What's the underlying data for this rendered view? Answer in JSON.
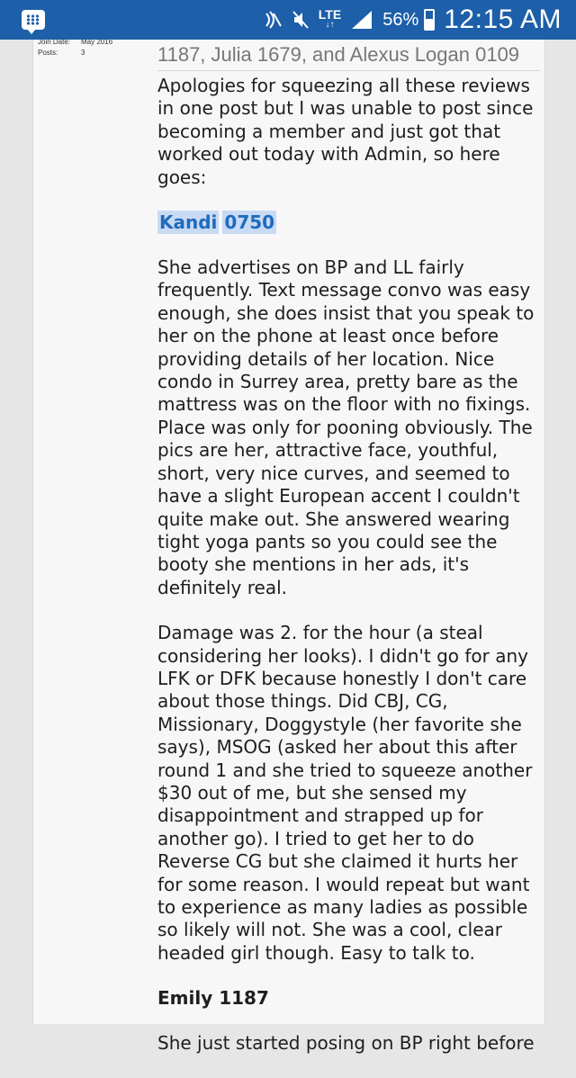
{
  "status_bar": {
    "network": "LTE",
    "battery": "56%",
    "battery_level": 0.56,
    "time": "12:15 AM"
  },
  "user_info": {
    "join_date_label": "Join Date:",
    "join_date": "May 2016",
    "posts_label": "Posts:",
    "posts": "3"
  },
  "post": {
    "title": "1187, Julia 1679, and Alexus Logan 0109",
    "intro": "Apologies for squeezing all these reviews in one post but I was unable to post since becoming a member and just got that worked out today with Admin, so here goes:",
    "sections": [
      {
        "name": "Kandi",
        "number": "0750",
        "paragraphs": [
          "She advertises on BP and LL fairly frequently. Text message convo was easy enough, she does insist that you speak to her on the phone at least once before providing details of her location. Nice condo in Surrey area, pretty bare as the mattress was on the floor with no fixings. Place was only for pooning obviously. The pics are her, attractive face, youthful, short, very nice curves, and seemed to have a slight European accent I couldn't quite make out. She answered wearing tight yoga pants so you could see the booty she mentions in her ads, it's definitely real.",
          "Damage was 2. for the hour (a steal considering her looks). I didn't go for any LFK or DFK because honestly I don't care about those things. Did CBJ, CG, Missionary, Doggystyle (her favorite she says), MSOG (asked her about this after round 1 and she tried to squeeze another $30 out of me, but she sensed my disappointment and strapped up for another go). I tried to get her to do Reverse CG but she claimed it hurts her for some reason. I would repeat but want to experience as many ladies as possible so likely will not. She was a cool, clear headed girl though. Easy to talk to."
        ]
      },
      {
        "name": "Emily 1187",
        "paragraphs": [
          "She just started posing on BP right before"
        ]
      }
    ]
  }
}
